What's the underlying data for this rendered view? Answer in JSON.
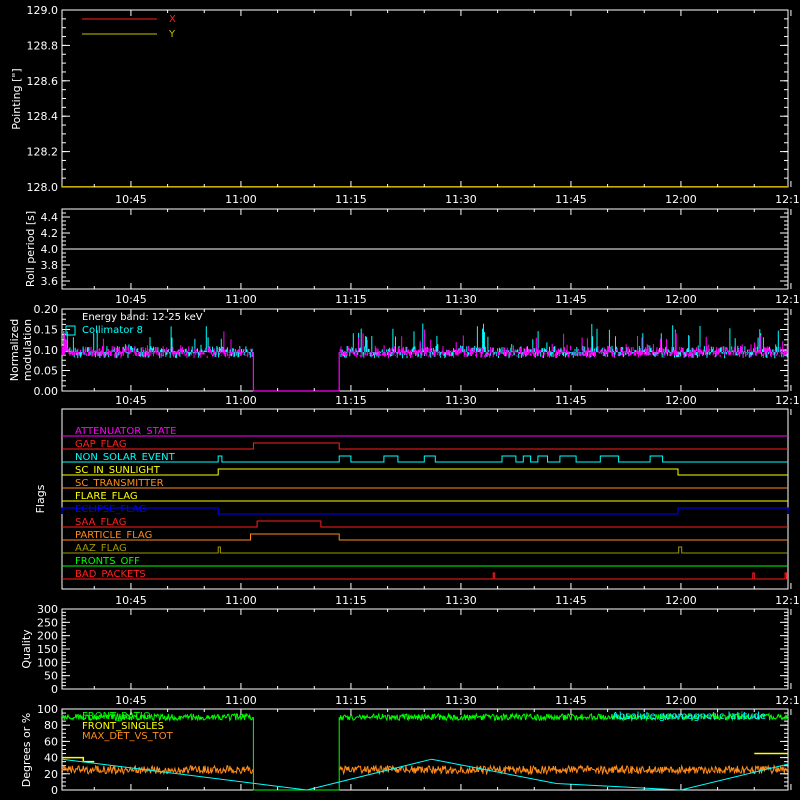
{
  "colors": {
    "background": "#000000",
    "axes": "#ffffff",
    "x_series": "#ff2020",
    "y_series": "#c8c000",
    "magenta": "#ff00ff",
    "cyan": "#00ffff",
    "green": "#00ff00",
    "orange": "#ff8c1a",
    "yellow": "#ffff00",
    "blue": "#0000ff",
    "red": "#ff0000",
    "olive": "#a09800"
  },
  "time_axis": {
    "ticks": [
      "10:45",
      "11:00",
      "11:15",
      "11:30",
      "11:45",
      "12:00",
      "12:15"
    ],
    "tick_minutes": [
      45,
      60,
      75,
      90,
      105,
      120,
      135
    ],
    "range_minutes": [
      35.6,
      134.6
    ]
  },
  "chart_data": [
    {
      "id": "pointing",
      "type": "line",
      "ylabel": "Pointing [\"]",
      "ylim": [
        128.0,
        129.0
      ],
      "yticks": [
        "128.0",
        "128.2",
        "128.4",
        "128.6",
        "128.8",
        "129.0"
      ],
      "ytick_values": [
        128.0,
        128.2,
        128.4,
        128.6,
        128.8,
        129.0
      ],
      "legend": [
        {
          "name": "X",
          "color": "#ff2020"
        },
        {
          "name": "Y",
          "color": "#c8c000"
        }
      ],
      "series": [
        {
          "name": "X",
          "color": "#ff2020",
          "x": [
            35.6,
            134.6
          ],
          "y": [
            128.0,
            128.0
          ]
        },
        {
          "name": "Y",
          "color": "#c8c000",
          "x": [
            35.6,
            134.6
          ],
          "y": [
            128.0,
            128.0
          ]
        }
      ]
    },
    {
      "id": "roll",
      "type": "line",
      "ylabel": "Roll period [s]",
      "ylim": [
        3.5,
        4.5
      ],
      "yticks": [
        "3.6",
        "3.8",
        "4.0",
        "4.2",
        "4.4"
      ],
      "ytick_values": [
        3.6,
        3.8,
        4.0,
        4.2,
        4.4
      ],
      "series": [
        {
          "color": "#ffffff",
          "x": [
            35.6,
            134.6
          ],
          "y": [
            4.0,
            4.0
          ]
        }
      ]
    },
    {
      "id": "modulation",
      "type": "line",
      "ylabel": "Normalized modulation",
      "ylabel_lines": [
        "Normalized",
        "modulation"
      ],
      "ylim": [
        0,
        0.2
      ],
      "yticks": [
        "0.00",
        "0.05",
        "0.10",
        "0.15",
        "0.20"
      ],
      "ytick_values": [
        0,
        0.05,
        0.1,
        0.15,
        0.2
      ],
      "annotation": "Energy band: 12-25 keV",
      "legend": [
        {
          "name": "Collimator 8",
          "color": "#00ffff"
        }
      ],
      "gaps": [
        [
          61.7,
          73.4
        ]
      ],
      "baseline": 0.095,
      "noise_amplitude": 0.03,
      "spike_max": 0.2
    },
    {
      "id": "flags",
      "type": "line",
      "ylabel": "Flags",
      "flags": [
        {
          "name": "ATTENUATOR_STATE",
          "color": "#ff00ff",
          "high": []
        },
        {
          "name": "GAP_FLAG",
          "color": "#ff2020",
          "high": [
            [
              61.7,
              73.4
            ]
          ]
        },
        {
          "name": "NON_SOLAR_EVENT",
          "color": "#00ffff",
          "high": [
            [
              56.9,
              57.4
            ],
            [
              73.4,
              75.0
            ],
            [
              79.5,
              81.4
            ],
            [
              85.0,
              86.5
            ],
            [
              95.6,
              97.5
            ],
            [
              98.5,
              99.5
            ],
            [
              100.5,
              101.8
            ],
            [
              103.5,
              105.7
            ],
            [
              109.0,
              111.5
            ],
            [
              115.8,
              117.5
            ]
          ]
        },
        {
          "name": "SC_IN_SUNLIGHT",
          "color": "#ffff00",
          "high": [
            [
              56.9,
              119.6
            ]
          ]
        },
        {
          "name": "SC_TRANSMITTER",
          "color": "#ff8c1a",
          "high": []
        },
        {
          "name": "FLARE_FLAG",
          "color": "#ffff00",
          "high": []
        },
        {
          "name": "ECLIPSE_FLAG",
          "color": "#0000ff",
          "high": [
            [
              35.6,
              56.9
            ],
            [
              119.6,
              134.6
            ]
          ]
        },
        {
          "name": "SAA_FLAG",
          "color": "#ff2020",
          "high": [
            [
              62.2,
              70.9
            ]
          ]
        },
        {
          "name": "PARTICLE_FLAG",
          "color": "#ff8c1a",
          "high": [
            [
              61.3,
              73.4
            ]
          ]
        },
        {
          "name": "AAZ_FLAG",
          "color": "#a09800",
          "high": [
            [
              56.9,
              57.2
            ],
            [
              119.7,
              120.1
            ]
          ]
        },
        {
          "name": "FRONTS_OFF",
          "color": "#00ff00",
          "high": []
        },
        {
          "name": "BAD_PACKETS",
          "color": "#ff2020",
          "high": [
            [
              94.4,
              94.6
            ],
            [
              129.8,
              130.0
            ],
            [
              134.2,
              134.4
            ]
          ]
        }
      ]
    },
    {
      "id": "quality",
      "type": "line",
      "ylabel": "Quality",
      "ylim": [
        0,
        300
      ],
      "yticks": [
        "0",
        "50",
        "100",
        "150",
        "200",
        "250",
        "300"
      ],
      "ytick_values": [
        0,
        50,
        100,
        150,
        200,
        250,
        300
      ],
      "series": []
    },
    {
      "id": "ratios",
      "type": "line",
      "ylabel": "Degrees or %",
      "ylim": [
        0,
        100
      ],
      "yticks": [
        "0",
        "20",
        "40",
        "60",
        "80",
        "100"
      ],
      "ytick_values": [
        0,
        20,
        40,
        60,
        80,
        100
      ],
      "legend": [
        {
          "name": "FRONT_RATIO",
          "color": "#00ff00"
        },
        {
          "name": "FRONT_SINGLES",
          "color": "#ffff00"
        },
        {
          "name": "MAX_DET_VS_TOT",
          "color": "#ff8c1a"
        },
        {
          "name": "Absolute geomagnetic latitude",
          "color": "#00ffff"
        }
      ],
      "gaps": [
        [
          61.7,
          73.4
        ]
      ],
      "front_ratio_level": 90,
      "max_det_level": 25,
      "front_singles": {
        "x": [
          35.6,
          38.5,
          38.5,
          40.0,
          40.0,
          130.0,
          130.0,
          134.6
        ],
        "y": [
          40,
          40,
          35,
          35,
          null,
          null,
          45,
          45
        ]
      },
      "latitude": {
        "x": [
          35.6,
          69.0,
          86.0,
          103.0,
          120.0,
          134.6
        ],
        "y": [
          38,
          0,
          38,
          8,
          0,
          32
        ]
      }
    }
  ]
}
